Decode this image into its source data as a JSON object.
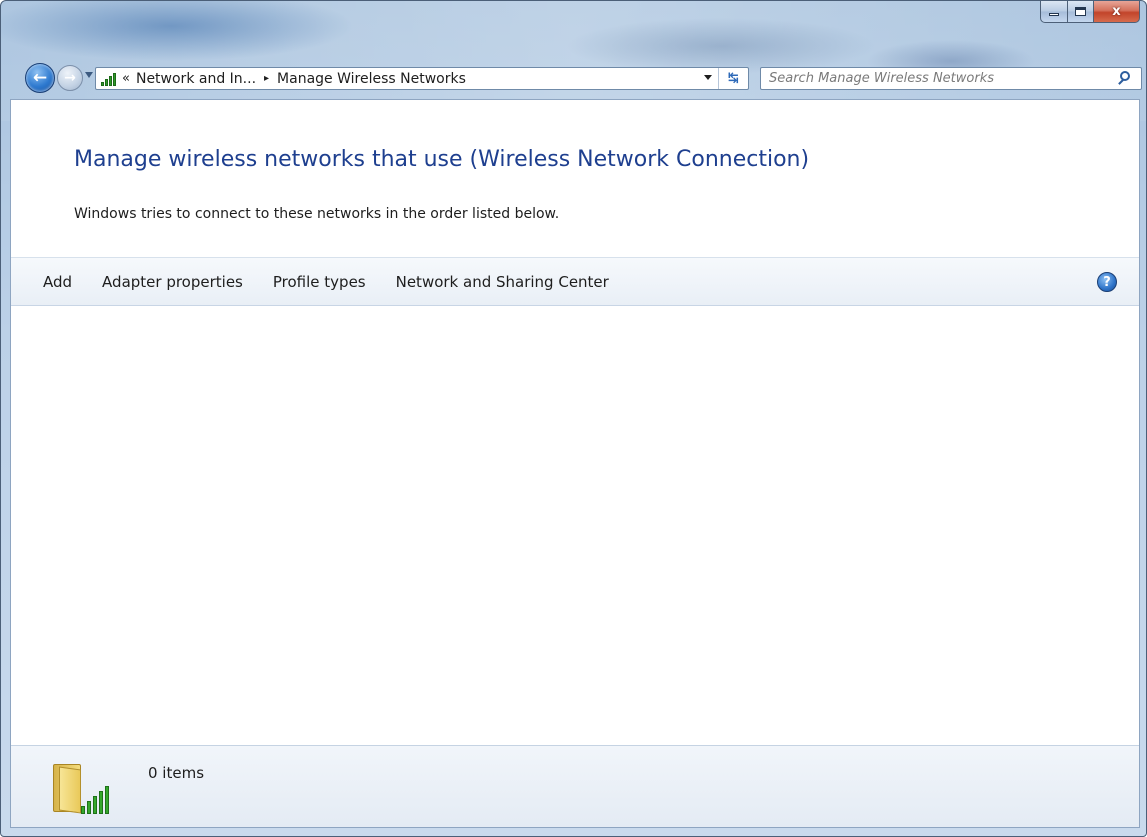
{
  "window": {
    "caption_buttons": {
      "minimize_label": "",
      "maximize_label": "",
      "close_label": "x"
    }
  },
  "nav": {
    "back_glyph": "←",
    "forward_glyph": "→",
    "address": {
      "overflow_chevron": "«",
      "crumbs": [
        "Network and In...",
        "Manage Wireless Networks"
      ],
      "separator": "▸",
      "icon": "wireless-signal-icon"
    },
    "refresh_glyph": "↹",
    "search": {
      "placeholder": "Search Manage Wireless Networks",
      "icon": "search-icon"
    }
  },
  "content": {
    "title": "Manage wireless networks that use (Wireless Network Connection)",
    "subtitle": "Windows tries to connect to these networks in the order listed below.",
    "command_bar": {
      "items": [
        "Add",
        "Adapter properties",
        "Profile types",
        "Network and Sharing Center"
      ],
      "help_glyph": "?"
    },
    "details": {
      "item_count": "0 items",
      "icon": "wireless-folder-icon"
    }
  },
  "colors": {
    "title_blue": "#1e3f8f",
    "signal_green": "#2f9a29",
    "close_red": "#c2442a"
  }
}
